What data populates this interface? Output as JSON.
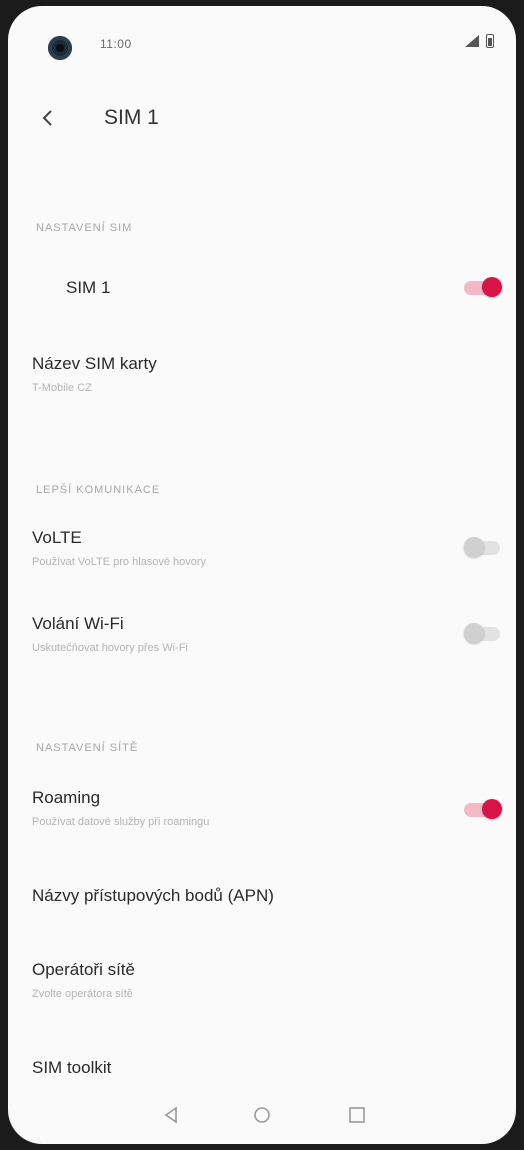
{
  "status_bar": {
    "time": "11:00"
  },
  "header": {
    "title": "SIM 1"
  },
  "sections": {
    "sim_settings": "NASTAVENÍ SIM",
    "calls": "LEPŠÍ KOMUNIKACE",
    "network": "NASTAVENÍ SÍTĚ"
  },
  "rows": {
    "sim_toggle": {
      "title": "SIM 1",
      "enabled": true
    },
    "sim_name": {
      "title": "Název SIM karty",
      "value": "T-Mobile CZ"
    },
    "volte": {
      "title": "VoLTE",
      "subtitle": "Používat VoLTE pro hlasové hovory",
      "enabled": false
    },
    "wifi_calling": {
      "title": "Volání Wi-Fi",
      "subtitle": "Uskutečňovat hovory přes Wi-Fi",
      "enabled": false
    },
    "roaming": {
      "title": "Roaming",
      "subtitle": "Používat datové služby při roamingu",
      "enabled": true
    },
    "apn": {
      "title": "Názvy přístupových bodů (APN)"
    },
    "operator": {
      "title": "Operátoři sítě",
      "subtitle": "Zvolte operátora sítě"
    },
    "sim_toolkit": {
      "title": "SIM toolkit"
    }
  },
  "colors": {
    "accent": "#d8134a",
    "accent_track": "#f4b9c6"
  },
  "icons": {
    "back": "back-arrow-icon",
    "nav_back": "nav-back-icon",
    "nav_home": "nav-home-icon",
    "nav_recents": "nav-recents-icon"
  }
}
